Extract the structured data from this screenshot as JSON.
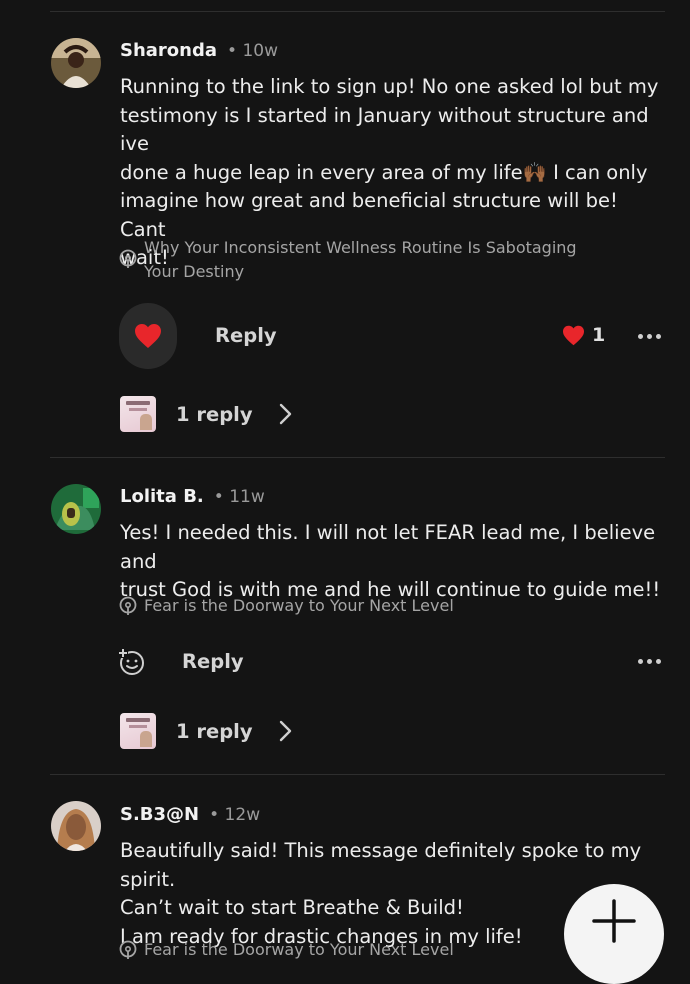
{
  "comments": [
    {
      "author": "Sharonda",
      "age": "• 10w",
      "lines": [
        "Running to the link to sign up! No one  asked lol but my",
        "testimony is I started in January without structure and ive",
        "done a huge leap in every area of my life🙌🏾 I can only",
        "imagine how great and beneficial structure will be! Cant",
        "wait!"
      ],
      "post_ref": [
        "Why Your Inconsistent Wellness Routine Is Sabotaging",
        "Your Destiny"
      ],
      "reply_label": "Reply",
      "like_count": "1",
      "replies_label": "1 reply"
    },
    {
      "author": "Lolita B.",
      "age": "• 11w",
      "lines": [
        "Yes! I needed this. I will not let FEAR lead me, I believe and",
        "trust God is with me and he will continue to guide me!!"
      ],
      "post_ref": [
        "Fear is the Doorway to Your Next Level"
      ],
      "reply_label": "Reply",
      "replies_label": "1 reply"
    },
    {
      "author": "S.B3@N",
      "age": "• 12w",
      "lines": [
        "Beautifully said!  This message definitely spoke to my spirit.",
        "Can’t wait to start Breathe & Build!",
        "I am ready for drastic changes in my life!"
      ],
      "post_ref": [
        "Fear is the Doorway to Your Next Level"
      ]
    }
  ],
  "colors": {
    "background": "#141414",
    "heart": "#e8262b",
    "muted_text": "#a5a5a5",
    "fab": "#f4f4f4"
  },
  "icons": {
    "post_ref": "message-bubble-icon",
    "like": "heart-icon",
    "add_reaction": "add-reaction-icon",
    "more": "more-dots-icon",
    "expand": "chevron-right-icon",
    "fab": "plus-icon"
  }
}
